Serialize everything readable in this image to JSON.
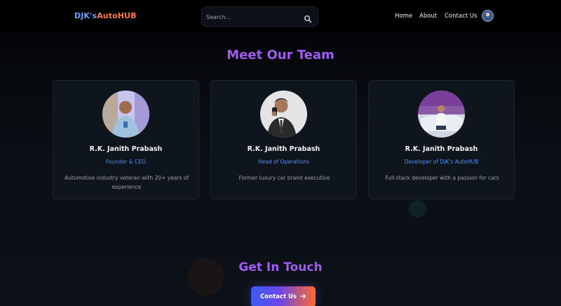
{
  "navbar": {
    "brand_part1": "DJK's",
    "brand_part2": "AutoHUB",
    "search_placeholder": "Search...",
    "links": [
      "Home",
      "About",
      "Contact Us"
    ],
    "icons": {
      "search": "search-icon",
      "profile": "avatar-icon"
    }
  },
  "team": {
    "title": "Meet Our Team",
    "members": [
      {
        "name": "R.K. Janith Prabash",
        "role": "Founder & CEO",
        "description": "Automotive industry veteran with 20+ years of experience"
      },
      {
        "name": "R.K. Janith Prabash",
        "role": "Head of Operations",
        "description": "Former luxury car brand executive"
      },
      {
        "name": "R.K. Janith Prabash",
        "role": "Developer of DJK's AutoHUB",
        "description": "Full-stack developer with a passion for cars"
      }
    ]
  },
  "contact": {
    "title": "Get In Touch",
    "button_label": "Contact Us",
    "button_icon": "arrow-right-icon"
  },
  "colors": {
    "accent_purple": "#a15bf0",
    "role_blue": "#4f8ff5",
    "brand_blue": "#6aa3ff",
    "brand_orange": "#ff7a3d"
  }
}
